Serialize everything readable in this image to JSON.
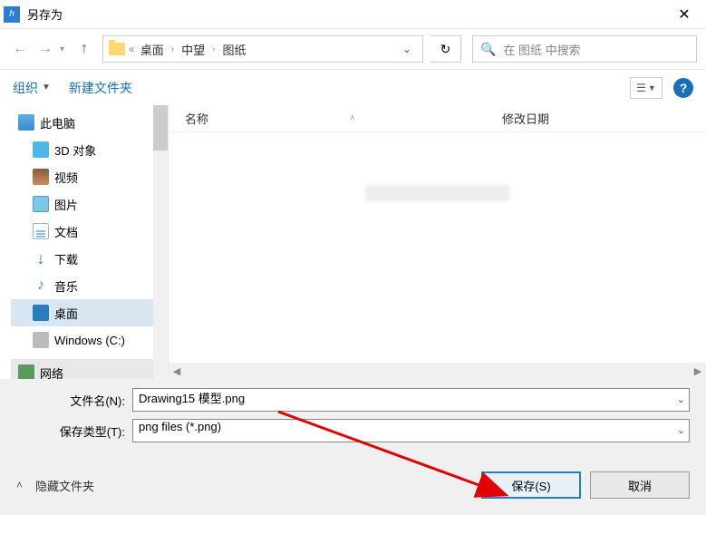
{
  "title": "另存为",
  "breadcrumb": {
    "p1": "桌面",
    "p2": "中望",
    "p3": "图纸"
  },
  "search": {
    "placeholder": "在 图纸 中搜索"
  },
  "toolbar": {
    "organize": "组织",
    "new_folder": "新建文件夹"
  },
  "columns": {
    "name": "名称",
    "date": "修改日期"
  },
  "tree": {
    "pc": "此电脑",
    "obj3d": "3D 对象",
    "video": "视频",
    "pictures": "图片",
    "documents": "文档",
    "downloads": "下载",
    "music": "音乐",
    "desktop": "桌面",
    "cdrive": "Windows (C:)",
    "network": "网络"
  },
  "fields": {
    "filename_label": "文件名(N):",
    "filename_value": "Drawing15 模型.png",
    "filetype_label": "保存类型(T):",
    "filetype_value": "png files (*.png)"
  },
  "footer": {
    "hide_folders": "隐藏文件夹",
    "save": "保存(S)",
    "cancel": "取消"
  }
}
